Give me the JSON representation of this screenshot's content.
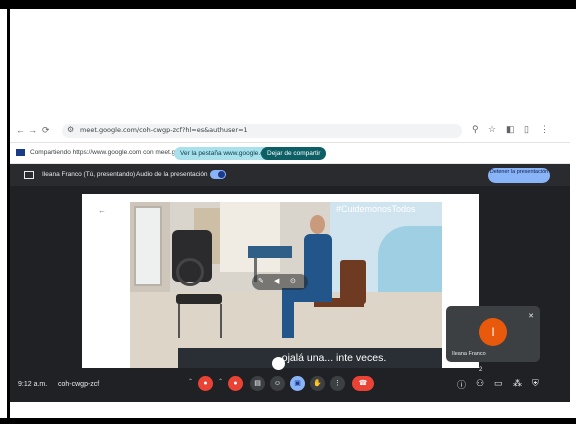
{
  "browser": {
    "url": "meet.google.com/coh-cwgp-zcf?hl=es&authuser=1",
    "nav": {
      "back": "←",
      "forward": "→",
      "reload": "⟳"
    },
    "icons": [
      "tune-icon",
      "translate-icon",
      "star-icon",
      "extension-icon",
      "menu-icon"
    ]
  },
  "share_bar": {
    "message": "Compartiendo https://www.google.com con meet.google.com",
    "view_tab_label": "Ver la pestaña www.google.com",
    "stop_share_label": "Dejar de compartir"
  },
  "meet": {
    "presenter_label": "Ileana Franco (Tú, presentando)",
    "audio_label": "Audio de la presentación",
    "stop_presenting_label": "Detener la presentación",
    "hashtag": "#CuidemonosTodos",
    "caption": "ojalá una... inte veces.",
    "self_tile": {
      "initial": "I",
      "name": "Ileana Franco"
    },
    "time": "9:12 a.m.",
    "meeting_code": "coh-cwgp-zcf",
    "participant_count": "2",
    "toggle_audio_on": true,
    "colors": {
      "accent": "#8ab4f8",
      "danger": "#ea4335",
      "avatar": "#e8590c",
      "stage": "#202124"
    }
  }
}
